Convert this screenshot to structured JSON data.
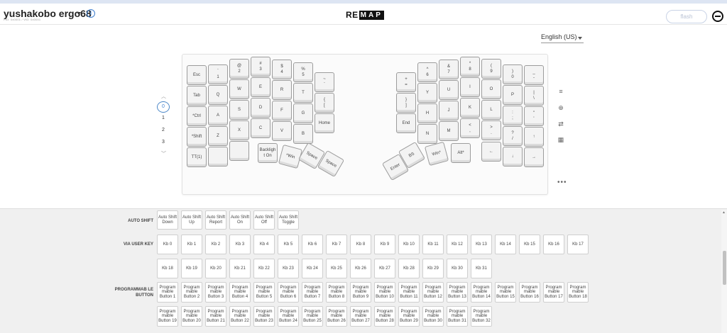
{
  "header": {
    "keyboard_name": "yushakobo ergo68",
    "subtitle": "PID: 0x0001 / VID: 0x0001",
    "logo_text": "RE",
    "logo_box": "MAP",
    "flash_label": "flash"
  },
  "language": "English (US)",
  "layers": {
    "up": "^",
    "down": "v",
    "items": [
      "0",
      "1",
      "2",
      "3"
    ],
    "active": "0"
  },
  "tools": {
    "icons": [
      "layers-icon",
      "move-icon",
      "swap-icon",
      "keyboard-icon"
    ],
    "glyphs": [
      "≡",
      "⊕",
      "⇄",
      "▦"
    ],
    "more": "•••"
  },
  "keys": [
    {
      "label": "Esc"
    },
    {
      "label": "`\n1"
    },
    {
      "label": "@\n2"
    },
    {
      "label": "#\n3"
    },
    {
      "label": "$\n4"
    },
    {
      "label": "%\n5"
    },
    {
      "label": "~\n`"
    },
    {
      "label": "Tab"
    },
    {
      "label": "Q"
    },
    {
      "label": "W"
    },
    {
      "label": "E"
    },
    {
      "label": "R"
    },
    {
      "label": "T"
    },
    {
      "label": "{\n["
    },
    {
      "label": "*Ctrl"
    },
    {
      "label": "A"
    },
    {
      "label": "S"
    },
    {
      "label": "D"
    },
    {
      "label": "F"
    },
    {
      "label": "G"
    },
    {
      "label": "Home"
    },
    {
      "label": "*Shift"
    },
    {
      "label": "Z"
    },
    {
      "label": "X"
    },
    {
      "label": "C"
    },
    {
      "label": "V"
    },
    {
      "label": "B"
    },
    {
      "label": "TT(1)"
    },
    {
      "label": ""
    },
    {
      "label": ""
    },
    {
      "label": "Backligh\nt On"
    },
    {
      "label": "*Win"
    },
    {
      "label": "Space"
    },
    {
      "label": "Space"
    },
    {
      "label": "+\n="
    },
    {
      "label": "^\n6"
    },
    {
      "label": "&\n7"
    },
    {
      "label": "*\n8"
    },
    {
      "label": "(\n9"
    },
    {
      "label": ")\n0"
    },
    {
      "label": "_\n-"
    },
    {
      "label": "}\n]"
    },
    {
      "label": "Y"
    },
    {
      "label": "U"
    },
    {
      "label": "I"
    },
    {
      "label": "O"
    },
    {
      "label": "P"
    },
    {
      "label": "|\n\\"
    },
    {
      "label": "End"
    },
    {
      "label": "H"
    },
    {
      "label": "J"
    },
    {
      "label": "K"
    },
    {
      "label": "L"
    },
    {
      "label": ":\n;"
    },
    {
      "label": "\"\n'"
    },
    {
      "label": "N"
    },
    {
      "label": "M"
    },
    {
      "label": "<\n,"
    },
    {
      "label": ">\n."
    },
    {
      "label": "?\n/"
    },
    {
      "label": "↑"
    },
    {
      "label": "Enter"
    },
    {
      "label": "BS"
    },
    {
      "label": "Win*"
    },
    {
      "label": "Alt*"
    },
    {
      "label": "←"
    },
    {
      "label": "↓"
    },
    {
      "label": "→"
    }
  ],
  "sections": {
    "auto_shift": {
      "title": "AUTO SHIFT",
      "keys": [
        "Auto Shift Down",
        "Auto Shift Up",
        "Auto Shift Report",
        "Auto Shift On",
        "Auto Shift Off",
        "Auto Shift Toggle"
      ]
    },
    "via_user_key": {
      "title": "VIA USER KEY",
      "keys": [
        "Kb 0",
        "Kb 1",
        "Kb 2",
        "Kb 3",
        "Kb 4",
        "Kb 5",
        "Kb 6",
        "Kb 7",
        "Kb 8",
        "Kb 9",
        "Kb 10",
        "Kb 11",
        "Kb 12",
        "Kb 13",
        "Kb 14",
        "Kb 15",
        "Kb 16",
        "Kb 17",
        "Kb 18",
        "Kb 19",
        "Kb 20",
        "Kb 21",
        "Kb 22",
        "Kb 23",
        "Kb 24",
        "Kb 25",
        "Kb 26",
        "Kb 27",
        "Kb 28",
        "Kb 29",
        "Kb 30",
        "Kb 31"
      ]
    },
    "programmable": {
      "title": "PROGRAMMAB LE BUTTON",
      "keys": [
        "Program mable Button 1",
        "Program mable Button 2",
        "Program mable Button 3",
        "Program mable Button 4",
        "Program mable Button 5",
        "Program mable Button 6",
        "Program mable Button 7",
        "Program mable Button 8",
        "Program mable Button 9",
        "Program mable Button 10",
        "Program mable Button 11",
        "Program mable Button 12",
        "Program mable Button 13",
        "Program mable Button 14",
        "Program mable Button 15",
        "Program mable Button 16",
        "Program mable Button 17",
        "Program mable Button 18",
        "Program mable Button 19",
        "Program mable Button 20",
        "Program mable Button 21",
        "Program mable Button 22",
        "Program mable Button 23",
        "Program mable Button 24",
        "Program mable Button 25",
        "Program mable Button 26",
        "Program mable Button 27",
        "Program mable Button 28",
        "Program mable Button 29",
        "Program mable Button 30",
        "Program mable Button 31",
        "Program mable Button 32"
      ]
    }
  }
}
